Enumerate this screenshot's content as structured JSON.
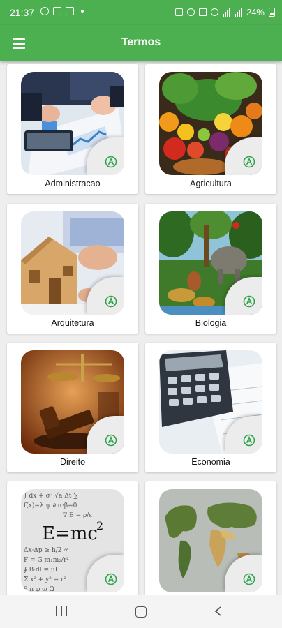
{
  "status_bar": {
    "time": "21:37",
    "battery_text": "24%"
  },
  "app_bar": {
    "title": "Termos",
    "menu_icon": "hamburger-menu-icon"
  },
  "categories": [
    {
      "label": "Administracao",
      "image": "business-documents-tablet"
    },
    {
      "label": "Agricultura",
      "image": "fruits-and-vegetables"
    },
    {
      "label": "Arquitetura",
      "image": "house-model"
    },
    {
      "label": "Biologia",
      "image": "jungle-animals"
    },
    {
      "label": "Direito",
      "image": "judge-gavel-scales"
    },
    {
      "label": "Economia",
      "image": "calculator-spreadsheet"
    },
    {
      "label": "",
      "image": "physics-formulas"
    },
    {
      "label": "",
      "image": "world-map"
    }
  ],
  "badge_icon": "app-a-badge-icon",
  "colors": {
    "primary": "#4caf50",
    "background": "#eeeeee",
    "card": "#ffffff"
  },
  "nav_bar": {
    "recents_icon": "recents-icon",
    "home_icon": "home-icon",
    "back_icon": "back-icon"
  }
}
